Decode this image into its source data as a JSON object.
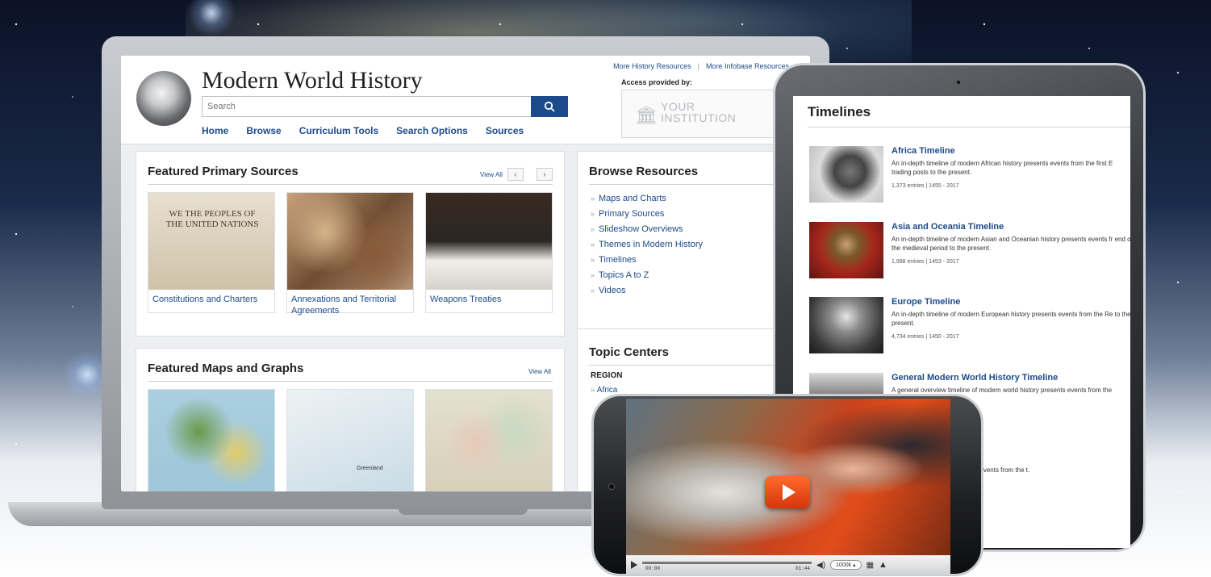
{
  "site": {
    "title": "Modern World History",
    "search_placeholder": "Search",
    "nav": [
      "Home",
      "Browse",
      "Curriculum Tools",
      "Search Options",
      "Sources"
    ],
    "top_links": [
      "More History Resources",
      "More Infobase Resources"
    ],
    "access_label": "Access provided by:",
    "institution": [
      "YOUR",
      "INSTITUTION"
    ]
  },
  "featured_sources": {
    "title": "Featured Primary Sources",
    "view_all": "View All",
    "items": [
      {
        "caption": "Constitutions and Charters",
        "image_text": "WE THE PEOPLES OF THE UNITED NATIONS"
      },
      {
        "caption": "Annexations and Territorial Agreements"
      },
      {
        "caption": "Weapons Treaties"
      }
    ]
  },
  "featured_maps": {
    "title": "Featured Maps and Graphs",
    "view_all": "View All",
    "map_label": "Greenland"
  },
  "browse": {
    "title": "Browse Resources",
    "items": [
      "Maps and Charts",
      "Primary Sources",
      "Slideshow Overviews",
      "Themes in Modern History",
      "Timelines",
      "Topics A to Z",
      "Videos"
    ]
  },
  "topics": {
    "title": "Topic Centers",
    "region_label": "REGION",
    "first_item": "Africa"
  },
  "timelines": {
    "title": "Timelines",
    "items": [
      {
        "title": "Africa Timeline",
        "desc": "An in-depth timeline of modern African history presents events from the first E trading posts to the present.",
        "meta": "1,373 entries  |  1455 - 2017"
      },
      {
        "title": "Asia and Oceania Timeline",
        "desc": "An in-depth timeline of modern Asian and Oceanian history presents events fr end of the medieval period to the present.",
        "meta": "1,998 entries  |  1453 - 2017"
      },
      {
        "title": "Europe Timeline",
        "desc": "An in-depth timeline of modern European history presents events from the Re to the present.",
        "meta": "4,734 entries  |  1450 - 2017"
      },
      {
        "title": "General Modern World History Timeline",
        "desc": "A general overview timeline of modern world history presents events from the present.",
        "meta": ""
      }
    ],
    "partial_desc": "n Middle East history presents events from the t."
  },
  "video": {
    "time_current": "00:00",
    "time_total": "01:44",
    "rate": "1000k"
  },
  "colors": {
    "link_blue": "#1c4a8a",
    "play_orange": "#e8481a"
  }
}
